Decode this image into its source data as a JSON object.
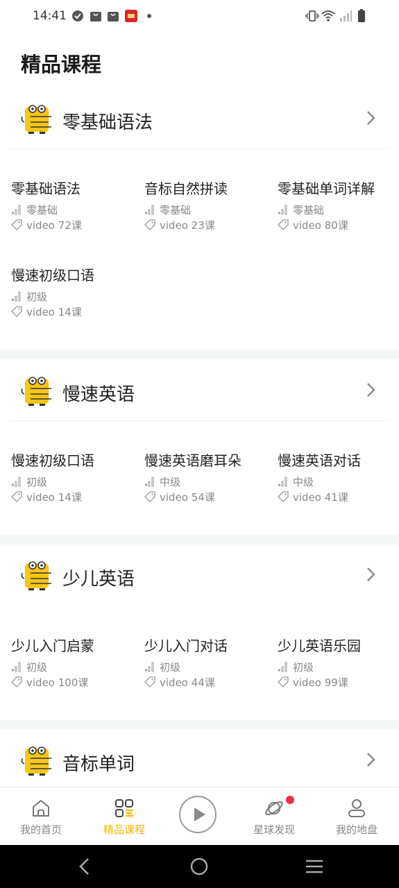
{
  "status_bar": {
    "time": "14:41"
  },
  "page": {
    "title": "精品课程"
  },
  "colors": {
    "accent": "#f2b800",
    "mascot": "#f5c518",
    "notification": "#e53048",
    "separator": "#f5f7f7"
  },
  "sections": [
    {
      "title": "零基础语法",
      "courses": [
        {
          "title": "零基础语法",
          "level": "零基础",
          "count": "video 72课"
        },
        {
          "title": "音标自然拼读",
          "level": "零基础",
          "count": "video 23课"
        },
        {
          "title": "零基础单词详解",
          "level": "零基础",
          "count": "video 80课"
        },
        {
          "title": "慢速初级口语",
          "level": "初级",
          "count": "video 14课"
        }
      ]
    },
    {
      "title": "慢速英语",
      "courses": [
        {
          "title": "慢速初级口语",
          "level": "初级",
          "count": "video 14课"
        },
        {
          "title": "慢速英语磨耳朵",
          "level": "中级",
          "count": "video 54课"
        },
        {
          "title": "慢速英语对话",
          "level": "中级",
          "count": "video 41课"
        }
      ]
    },
    {
      "title": "少儿英语",
      "courses": [
        {
          "title": "少儿入门启蒙",
          "level": "初级",
          "count": "video 100课"
        },
        {
          "title": "少儿入门对话",
          "level": "初级",
          "count": "video 44课"
        },
        {
          "title": "少儿英语乐园",
          "level": "初级",
          "count": "video 99课"
        }
      ]
    },
    {
      "title": "音标单词",
      "courses": []
    }
  ],
  "bottom_nav": [
    {
      "label": "我的首页",
      "icon": "home-icon",
      "active": false
    },
    {
      "label": "精品课程",
      "icon": "courses-grid-icon",
      "active": true
    },
    {
      "label": "",
      "icon": "play-icon",
      "active": false
    },
    {
      "label": "星球发现",
      "icon": "planet-icon",
      "active": false,
      "badge": true
    },
    {
      "label": "我的地盘",
      "icon": "user-icon",
      "active": false
    }
  ]
}
